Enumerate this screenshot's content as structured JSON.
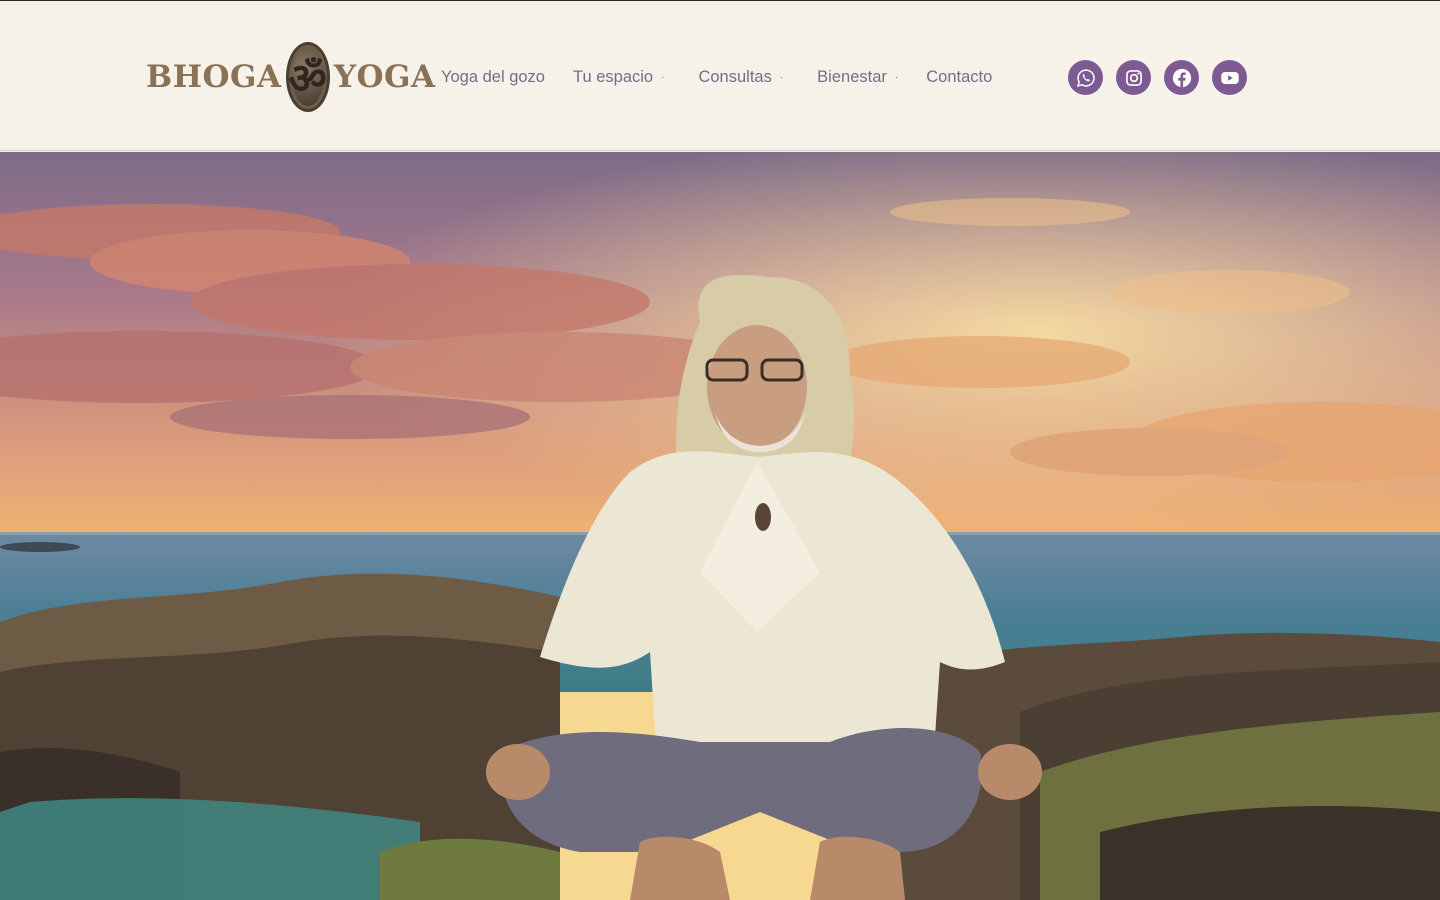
{
  "brand": {
    "left_word": "BHOGA",
    "right_word": "YOGA",
    "symbol": "ॐ"
  },
  "nav": {
    "items": [
      {
        "label": "Yoga del gozo",
        "dropdown": false
      },
      {
        "label": "Tu espacio",
        "dropdown": true
      },
      {
        "label": "Consultas",
        "dropdown": true
      },
      {
        "label": "Bienestar",
        "dropdown": true
      },
      {
        "label": "Contacto",
        "dropdown": false
      }
    ],
    "dropdown_marker": "·"
  },
  "social": [
    {
      "name": "whatsapp",
      "icon": "whatsapp-icon"
    },
    {
      "name": "instagram",
      "icon": "instagram-icon"
    },
    {
      "name": "facebook",
      "icon": "facebook-icon"
    },
    {
      "name": "youtube",
      "icon": "youtube-icon"
    }
  ],
  "colors": {
    "header_bg": "#f6f2ea",
    "nav_text": "#7b6a86",
    "social_bg": "#7e5a93",
    "logo_text": "#8a7256"
  },
  "hero": {
    "image": "man-with-long-white-hair-meditating-in-squat-on-seaside-rocks-at-sunset"
  }
}
